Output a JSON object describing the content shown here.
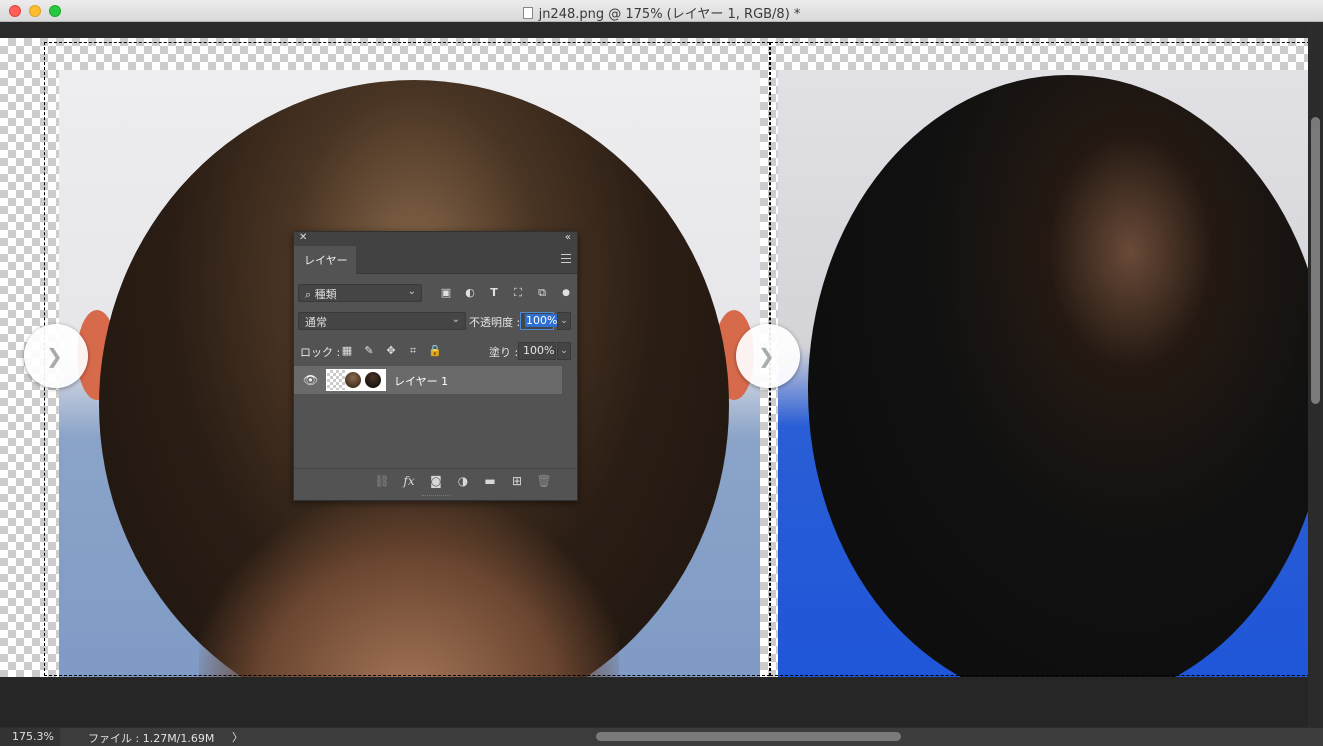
{
  "window": {
    "title": "jn248.png @ 175% (レイヤー 1, RGB/8) *"
  },
  "layers_panel": {
    "tab_label": "レイヤー",
    "filter_kind": "種類",
    "blend_mode": "通常",
    "opacity_label": "不透明度 :",
    "opacity_value": "100%",
    "lock_label": "ロック :",
    "fill_label": "塗り :",
    "fill_value": "100%",
    "layers": [
      {
        "name": "レイヤー 1",
        "visible": true
      }
    ]
  },
  "status_bar": {
    "zoom": "175.3%",
    "file_info": "ファイル : 1.27M/1.69M"
  },
  "colors": {
    "panel_bg": "#535353",
    "selected_layer": "#6a6a6a",
    "focus_accent": "#2f6fd0"
  }
}
